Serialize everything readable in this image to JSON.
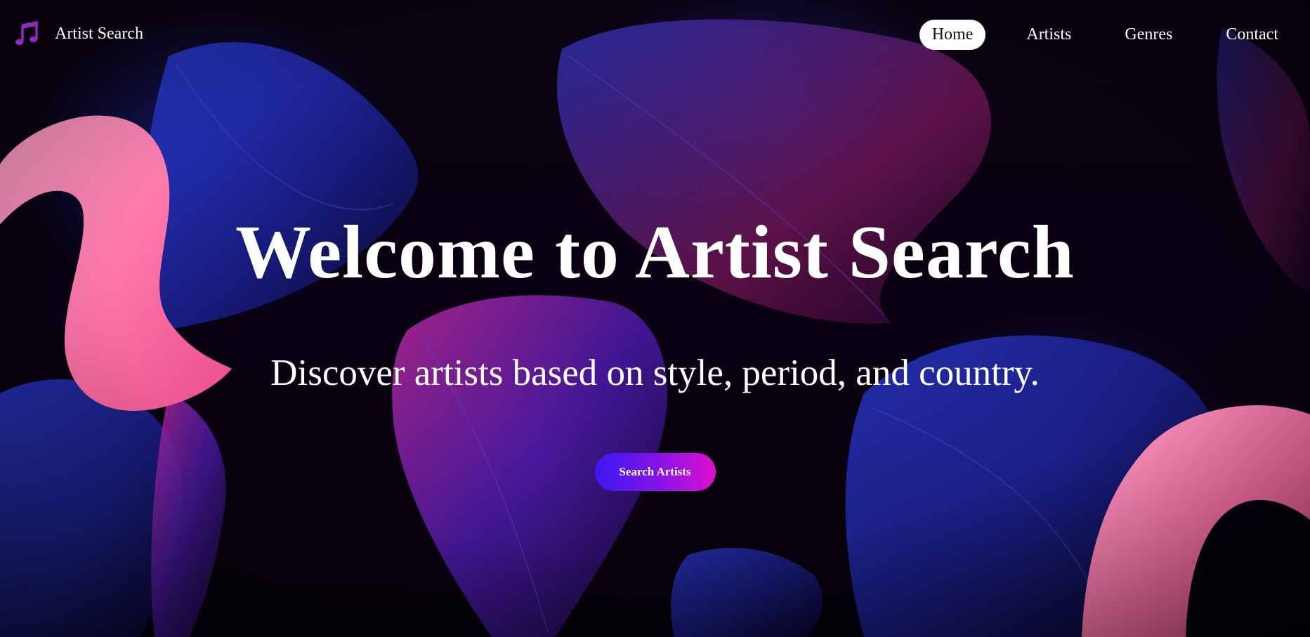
{
  "brand": {
    "icon": "music-note-icon",
    "name": "Artist Search"
  },
  "nav": {
    "items": [
      {
        "label": "Home",
        "active": true
      },
      {
        "label": "Artists",
        "active": false
      },
      {
        "label": "Genres",
        "active": false
      },
      {
        "label": "Contact",
        "active": false
      }
    ]
  },
  "hero": {
    "title": "Welcome to Artist Search",
    "subtitle": "Discover artists based on style, period, and country.",
    "cta_label": "Search Artists"
  },
  "colors": {
    "accent_start": "#3a18f2",
    "accent_end": "#e010cf",
    "logo_icon": "#8e2bbd",
    "ribbon_pink": "#ff7fb0"
  }
}
